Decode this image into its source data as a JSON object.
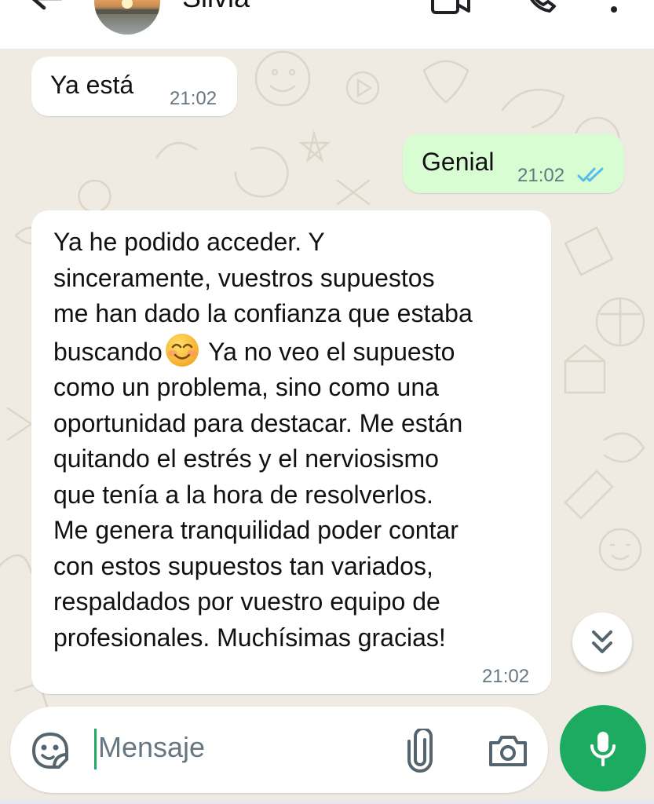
{
  "header": {
    "contact_name": "Silvia",
    "icons": [
      "back-arrow-icon",
      "video-call-icon",
      "voice-call-icon",
      "more-options-icon"
    ]
  },
  "messages": [
    {
      "direction": "incoming",
      "text": "Ya está",
      "time": "21:02"
    },
    {
      "direction": "outgoing",
      "text": "Genial",
      "time": "21:02",
      "status": "read",
      "status_color": "#53bdeb"
    },
    {
      "direction": "incoming",
      "text_before_emoji": "Ya he podido acceder. Y\nsinceramente, vuestros supuestos\nme han dado la confianza que estaba\nbuscando",
      "emoji": "smiling-face-icon",
      "text_after_emoji": " Ya no veo el supuesto\ncomo un problema, sino como una\noportunidad para destacar. Me están\nquitando el estrés y el nerviosismo\nque tenía a la hora de resolverlos.\nMe genera tranquilidad poder contar\ncon estos supuestos tan variados,\nrespaldados por vuestro equipo de\nprofesionales. Muchísimas gracias!",
      "time": "21:02"
    }
  ],
  "composer": {
    "placeholder": "Mensaje",
    "icons": [
      "sticker-icon",
      "attach-icon",
      "camera-icon",
      "microphone-icon"
    ]
  },
  "colors": {
    "accent_green": "#1daa61",
    "outgoing_bubble": "#d9fdd3",
    "incoming_bubble": "#ffffff",
    "chat_background": "#efeae2",
    "read_ticks": "#53bdeb"
  }
}
